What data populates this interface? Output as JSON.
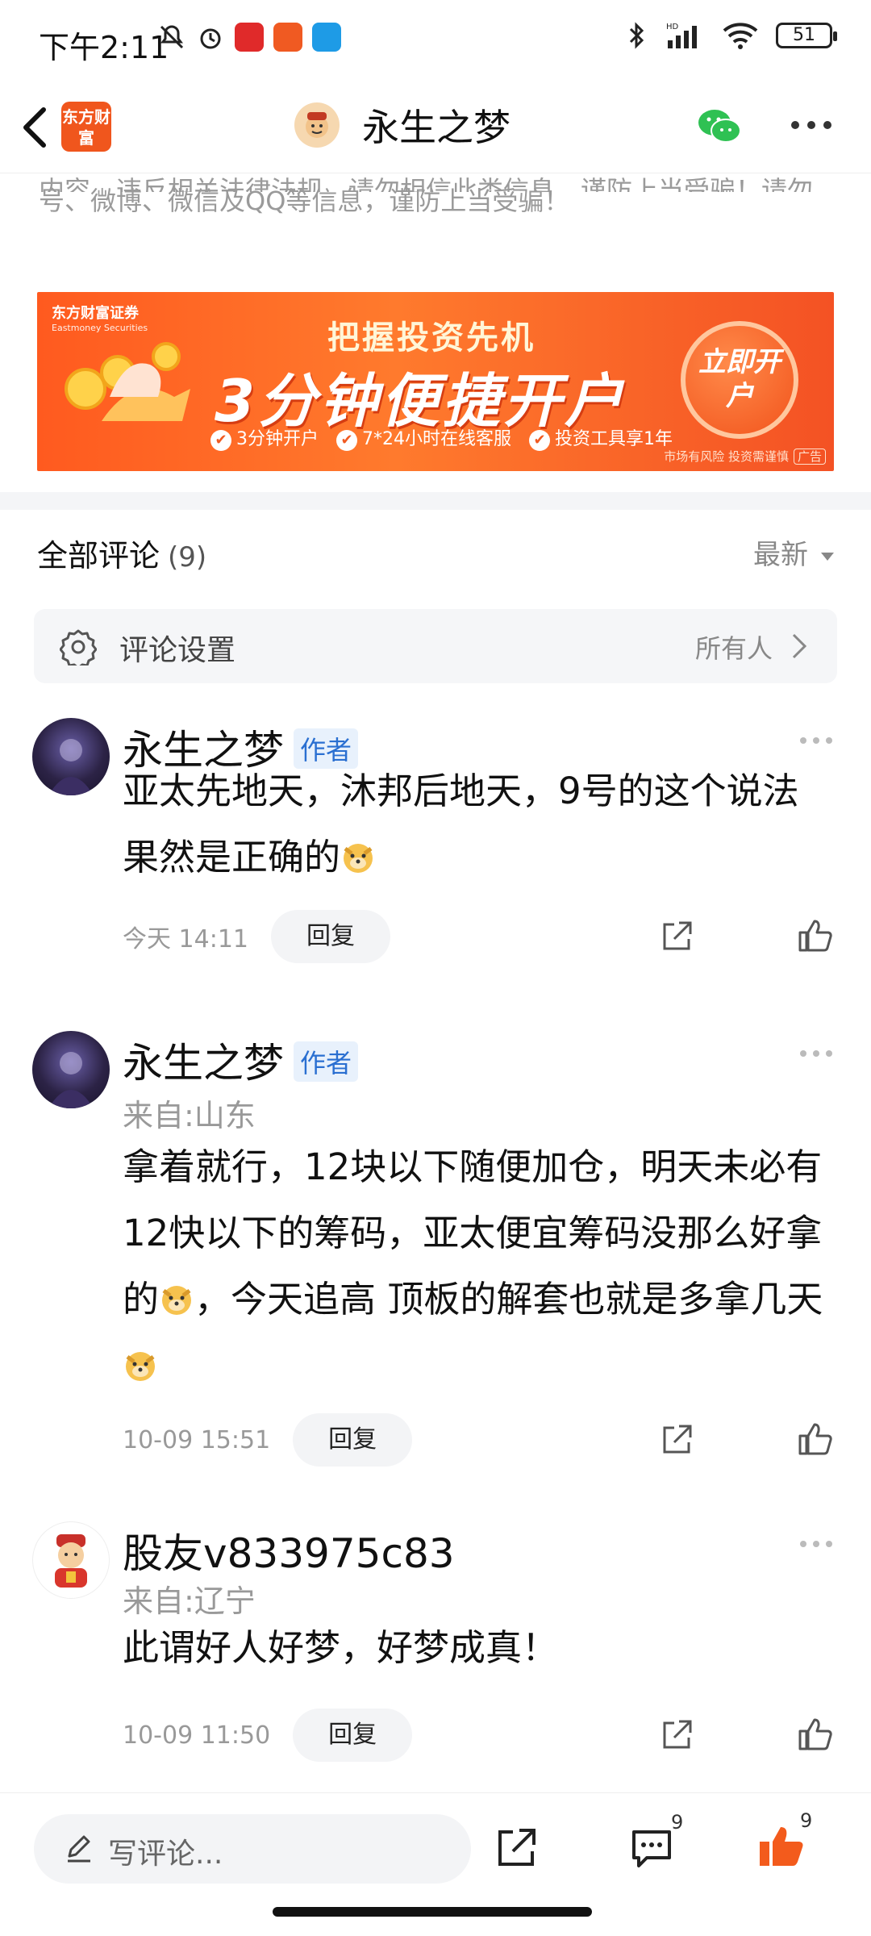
{
  "status_bar": {
    "time": "下午2:11",
    "network": "HD",
    "battery": "51"
  },
  "nav": {
    "logo_text": "东方财富",
    "title": "永生之梦"
  },
  "disclaimer": {
    "top_partial": "内容，违反相关法律法规，请勿相信此类信息，谨防上当受骗！请勿相信任何微信号、",
    "line": "号、微博、微信及QQ等信息，谨防上当受骗！"
  },
  "banner": {
    "brand": "东方财富证券",
    "brand_en": "Eastmoney Securities",
    "headline": "把握投资先机",
    "main": "3分钟便捷开户",
    "features": [
      "3分钟开户",
      "7*24小时在线客服",
      "投资工具享1年"
    ],
    "cta": "立即开户",
    "risk": "市场有风险 投资需谨慎",
    "ad_tag": "广告",
    "colors": {
      "bg": "#ff5a1f"
    }
  },
  "comments_header": {
    "title": "全部评论",
    "count": "(9)",
    "sort": "最新"
  },
  "settings": {
    "label": "评论设置",
    "value": "所有人"
  },
  "comments": [
    {
      "name": "永生之梦",
      "badge": "作者",
      "location": "",
      "text_parts": [
        "亚太先地天，沐邦后地天，9号的这个说法果然是正确的"
      ],
      "time": "今天 14:11",
      "reply": "回复"
    },
    {
      "name": "永生之梦",
      "badge": "作者",
      "location": "来自:山东",
      "text_parts": [
        "拿着就行，12块以下随便加仓，明天未必有12快以下的筹码，亚太便宜筹码没那么好拿的",
        "，今天追高 顶板的解套也就是多拿几天"
      ],
      "time": "10-09 15:51",
      "reply": "回复"
    },
    {
      "name": "股友v833975c83",
      "badge": "",
      "location": "来自:辽宁",
      "text_parts": [
        "此谓好人好梦，好梦成真！"
      ],
      "time": "10-09 11:50",
      "reply": "回复"
    }
  ],
  "bottom_bar": {
    "placeholder": "写评论...",
    "comment_count": "9",
    "like_count": "9",
    "like_color": "#f35b1c"
  }
}
